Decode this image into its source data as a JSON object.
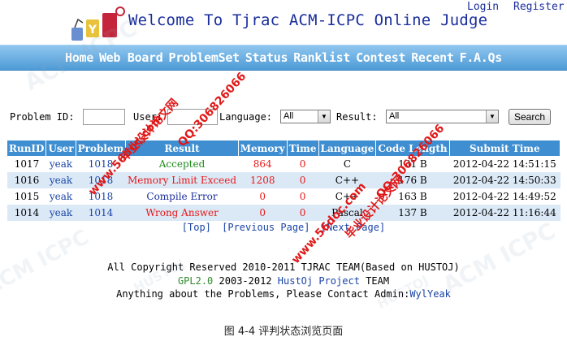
{
  "header": {
    "title": "Welcome To Tjrac ACM-ICPC Online Judge",
    "login": "Login",
    "register": "Register",
    "colors": {
      "title": "#1a2e9c",
      "nav_bg": "#4e9bd6"
    }
  },
  "nav": {
    "items": [
      "Home",
      "Web Board",
      "ProblemSet",
      "Status",
      "Ranklist",
      "Contest",
      "Recent",
      "F.A.Qs"
    ]
  },
  "filter": {
    "problem_id_label": "Problem ID:",
    "problem_id_value": "",
    "user_label": "User:",
    "user_value": "",
    "language_label": "Language:",
    "language_selected": "All",
    "result_label": "Result:",
    "result_selected": "All",
    "search_button": "Search"
  },
  "table": {
    "headers": [
      "RunID",
      "User",
      "Problem",
      "Result",
      "Memory",
      "Time",
      "Language",
      "Code Length",
      "Submit Time"
    ],
    "rows": [
      {
        "run_id": "1017",
        "user": "yeak",
        "problem": "1018",
        "result": "Accepted",
        "memory": "864",
        "time": "0",
        "language": "C",
        "code_length": "131 B",
        "submit_time": "2012-04-22 14:51:15"
      },
      {
        "run_id": "1016",
        "user": "yeak",
        "problem": "1018",
        "result": "Memory Limit Exceed",
        "memory": "1208",
        "time": "0",
        "language": "C++",
        "code_length": "176 B",
        "submit_time": "2012-04-22 14:50:33"
      },
      {
        "run_id": "1015",
        "user": "yeak",
        "problem": "1018",
        "result": "Compile Error",
        "memory": "0",
        "time": "0",
        "language": "C++",
        "code_length": "163 B",
        "submit_time": "2012-04-22 14:49:52"
      },
      {
        "run_id": "1014",
        "user": "yeak",
        "problem": "1014",
        "result": "Wrong Answer",
        "memory": "0",
        "time": "0",
        "language": "Pascal",
        "code_length": "137 B",
        "submit_time": "2012-04-22 11:16:44"
      }
    ]
  },
  "pager": {
    "top": "[Top]",
    "previous": "[Previous Page]",
    "next": "[Next Page]"
  },
  "footer": {
    "line1": "All Copyright Reserved 2010-2011 TJRAC TEAM(Based on HUSTOJ)",
    "gpl": "GPL2.0",
    "line2_mid": " 2003-2012 ",
    "project": "HustOj Project",
    "line2_end": " TEAM",
    "line3": "Anything about the Problems, Please Contact Admin:",
    "admin": "WylYeak"
  },
  "caption": "图 4-4  评判状态浏览页面",
  "watermarks": {
    "site": "www.56doc.com",
    "brand": "毕业设计论文网",
    "qq": "QQ:306826066",
    "faint1": "HUSTOJ",
    "faint2": "ACM ICPC"
  }
}
